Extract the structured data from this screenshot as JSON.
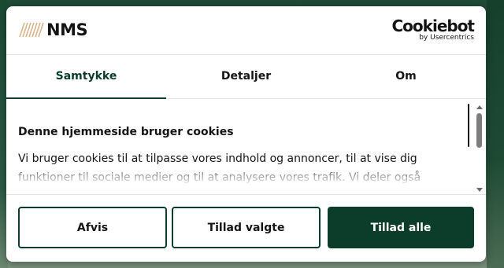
{
  "header": {
    "logo_text": "NMS",
    "cookiebot_word": "Cookiebot",
    "cookiebot_sub": "by Usercentrics"
  },
  "tabs": [
    {
      "label": "Samtykke",
      "active": true
    },
    {
      "label": "Detaljer",
      "active": false
    },
    {
      "label": "Om",
      "active": false
    }
  ],
  "content": {
    "title": "Denne hjemmeside bruger cookies",
    "body": "Vi bruger cookies til at tilpasse vores indhold og annoncer, til at vise dig funktioner til sociale medier og til at analysere vores trafik. Vi deler også"
  },
  "buttons": {
    "decline": "Afvis",
    "allow_selection": "Tillad valgte",
    "allow_all": "Tillad alle"
  },
  "colors": {
    "brand_green": "#0b3d2a",
    "text": "#141414"
  },
  "icons": [
    "nms-logo-icon",
    "scroll-up-icon",
    "scroll-down-icon"
  ]
}
